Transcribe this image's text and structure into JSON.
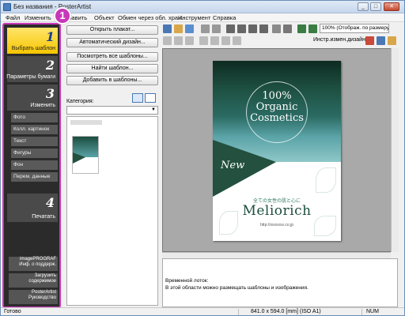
{
  "window": {
    "title": "Без названия - PosterArtist"
  },
  "menu": [
    "Файл",
    "Изменить",
    "Добавить",
    "Объект",
    "Обмен через обл. хран.",
    "Инструмент",
    "Справка"
  ],
  "annotation_badge": "1",
  "nav": {
    "steps": [
      {
        "num": "1",
        "label": "Выбрать шаблон"
      },
      {
        "num": "2",
        "label": "Параметры бумаги"
      },
      {
        "num": "3",
        "label": "Изменить"
      },
      {
        "num": "4",
        "label": "Печатать"
      }
    ],
    "sub_items": [
      "Фото",
      "Колл. картинок",
      "Текст",
      "Фигуры",
      "Фон",
      "Перем. данные"
    ],
    "bottom_items": [
      {
        "line1": "imagePROGRAF",
        "line2": "Инф. о поддерж."
      },
      {
        "line1": "Загрузить",
        "line2": "содержимое"
      },
      {
        "line1": "PosterArtist",
        "line2": "Руководство"
      }
    ]
  },
  "template_panel": {
    "buttons": [
      "Открыть плакат...",
      "Автоматический дизайн...",
      "Посмотреть все шаблоны...",
      "Найти шаблон...",
      "Добавить в шаблоны..."
    ],
    "category_label": "Категория:",
    "category_value": ""
  },
  "toolbar": {
    "zoom": "100% (Отображ. по размеру)",
    "design_tools_label": "Инстр.измен.дизайна"
  },
  "poster": {
    "headline_1": "100%",
    "headline_2": "Organic",
    "headline_3": "Cosmetics",
    "tag": "New",
    "jp_text": "全ての女性の肌と心に",
    "brand": "Meliorich",
    "url": "http://xxxxxxx.co.jp"
  },
  "tray": {
    "title": "Временной лоток:",
    "hint": "В этой области можно размещать шаблоны и изображения."
  },
  "status": {
    "left": "Готово",
    "size": "841.0 x 594.0 [mm] (ISO A1)",
    "num": "NUM"
  }
}
